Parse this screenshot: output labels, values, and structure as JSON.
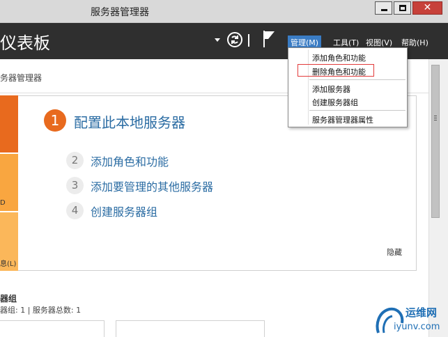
{
  "window": {
    "title": "服务器管理器",
    "close_glyph": "✕"
  },
  "header": {
    "title": "仪表板",
    "menu": {
      "manage": "管理(M)",
      "tools": "工具(T)",
      "view": "视图(V)",
      "help": "帮助(H)"
    },
    "icons": [
      "dropdown-arrow-icon",
      "refresh-icon",
      "flag-icon"
    ]
  },
  "dropdown": {
    "items": [
      "添加角色和功能",
      "删除角色和功能",
      "添加服务器",
      "创建服务器组",
      "服务器管理器属性"
    ],
    "highlight_color": "#e23a3a"
  },
  "content": {
    "breadcrumb": "务器管理器",
    "tiles": {
      "tile2_label": "D",
      "tile3_label": "息(L)"
    },
    "steps": {
      "main": {
        "number": "1",
        "label": "配置此本地服务器"
      },
      "items": [
        {
          "number": "2",
          "label": "添加角色和功能"
        },
        {
          "number": "3",
          "label": "添加要管理的其他服务器"
        },
        {
          "number": "4",
          "label": "创建服务器组"
        }
      ]
    },
    "hide_label": "隐藏",
    "group_title": "器组",
    "group_stats": "器组: 1 | 服务器总数: 1"
  },
  "watermark": {
    "top": "运维网",
    "bottom": "iyunv.com"
  },
  "colors": {
    "accent_orange": "#e86a1e",
    "tile_light": "#f9a640",
    "link_blue": "#2b6ca3",
    "menu_active": "#3a7cc4",
    "header_dark": "#2f2f2f"
  }
}
